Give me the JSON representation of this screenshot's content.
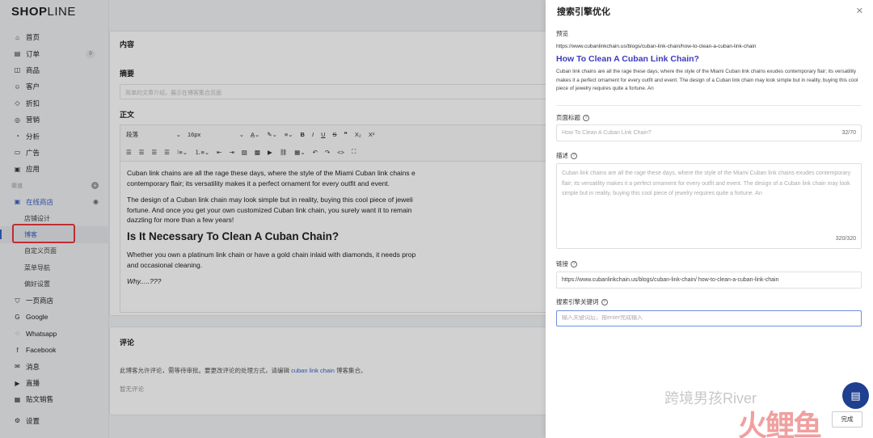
{
  "app": {
    "logo_bold": "SHOP",
    "logo_rest": "LINE"
  },
  "sidebar": {
    "items": [
      {
        "label": "首页",
        "icon": "home-icon",
        "glyph": "⌂"
      },
      {
        "label": "订单",
        "icon": "order-icon",
        "glyph": "▤",
        "badge": "0"
      },
      {
        "label": "商品",
        "icon": "product-icon",
        "glyph": "◫"
      },
      {
        "label": "客户",
        "icon": "customer-icon",
        "glyph": "☺"
      },
      {
        "label": "折扣",
        "icon": "discount-icon",
        "glyph": "◇"
      },
      {
        "label": "营销",
        "icon": "marketing-icon",
        "glyph": "◎"
      },
      {
        "label": "分析",
        "icon": "analytics-icon",
        "glyph": "◔"
      },
      {
        "label": "广告",
        "icon": "ads-icon",
        "glyph": "▭"
      },
      {
        "label": "应用",
        "icon": "apps-icon",
        "glyph": "▣"
      }
    ],
    "section_label": "渠道",
    "channel_label": "在线商店",
    "sub_items": [
      "店铺设计",
      "博客",
      "自定义页面",
      "菜单导航",
      "偏好设置"
    ],
    "active_sub": "博客",
    "channels": [
      {
        "label": "一页商店",
        "icon": "one-page-store-icon",
        "glyph": "⛉"
      },
      {
        "label": "Google",
        "icon": "google-icon",
        "glyph": "G"
      },
      {
        "label": "Whatsapp",
        "icon": "whatsapp-icon",
        "glyph": "◌"
      },
      {
        "label": "Facebook",
        "icon": "facebook-icon",
        "glyph": "f"
      },
      {
        "label": "消息",
        "icon": "message-icon",
        "glyph": "✉"
      },
      {
        "label": "直播",
        "icon": "live-icon",
        "glyph": "▶"
      },
      {
        "label": "贴文销售",
        "icon": "post-sales-icon",
        "glyph": "▦"
      }
    ],
    "settings_label": "设置"
  },
  "editor": {
    "content_title": "内容",
    "summary_label": "摘要",
    "summary_placeholder": "简单的文章介绍，展示在博客集合页面",
    "body_label": "正文",
    "toolbar": {
      "paragraph": "段落",
      "font_size": "16px"
    },
    "paragraphs": [
      "Cuban link chains are all the rage these days, where the style of the Miami Cuban link chains e",
      "contemporary flair; its versatility makes it a perfect ornament for every outfit and event.",
      "The design of a Cuban link chain may look simple but in reality, buying this cool piece of jeweli",
      "fortune. And once you get your own customized Cuban link chain, you surely want it to remain",
      "dazzling for more than a few years!"
    ],
    "heading": "Is It Necessary To Clean A Cuban Chain?",
    "paragraph2": [
      "Whether you own a platinum link chain or have a gold chain inlaid with diamonds, it needs prop",
      "and occasional cleaning."
    ],
    "italic_line": "Why.....???"
  },
  "comments": {
    "title": "评论",
    "text_before": "此博客允许评论，需等待审批。要更改评论的处理方式，请编辑 ",
    "link": "cuban link chain",
    "text_after": " 博客集合。",
    "empty": "暂无评论"
  },
  "seo": {
    "title": "搜索引擎优化",
    "preview_label": "预览",
    "preview_url": "https://www.cubanlinkchain.us/blogs/cuban-link-chain/how-to-clean-a-cuban-link-chain",
    "preview_title": "How To Clean A Cuban Link Chain?",
    "preview_desc": "Cuban link chains are all the rage these days, where the style of the Miami Cuban link chains exudes contemporary flair; its versatility makes it a perfect ornament for every outfit and event. The design of a Cuban link chain may look simple but in reality, buying this cool piece of jewelry requires quite a fortune. An",
    "page_title_label": "页面标题",
    "page_title_value": "How To Clean A Cuban Link Chain?",
    "page_title_counter": "32/70",
    "desc_label": "描述",
    "desc_value": "Cuban link chains are all the rage these days, where the style of the Miami Cuban link chains exudes contemporary flair; its versatility makes it a perfect ornament for every outfit and event. The design of a Cuban link chain may look simple but in reality, buying this cool piece of jewelry requires quite a fortune. An",
    "desc_counter": "320/320",
    "link_label": "链接",
    "link_value": "https://www.cubanlinkchain.us/blogs/cuban-link-chain/ how-to-clean-a-cuban-link-chain",
    "keyword_label": "搜索引擎关键词",
    "keyword_placeholder": "输入关键词后，按enter完成输入",
    "done": "完成"
  },
  "watermark": {
    "text": "跨境男孩River",
    "logo": "火鲤鱼"
  },
  "colors": {
    "accent": "#3b62c6",
    "highlight": "#e8383d",
    "chat": "#1f3f8f"
  }
}
